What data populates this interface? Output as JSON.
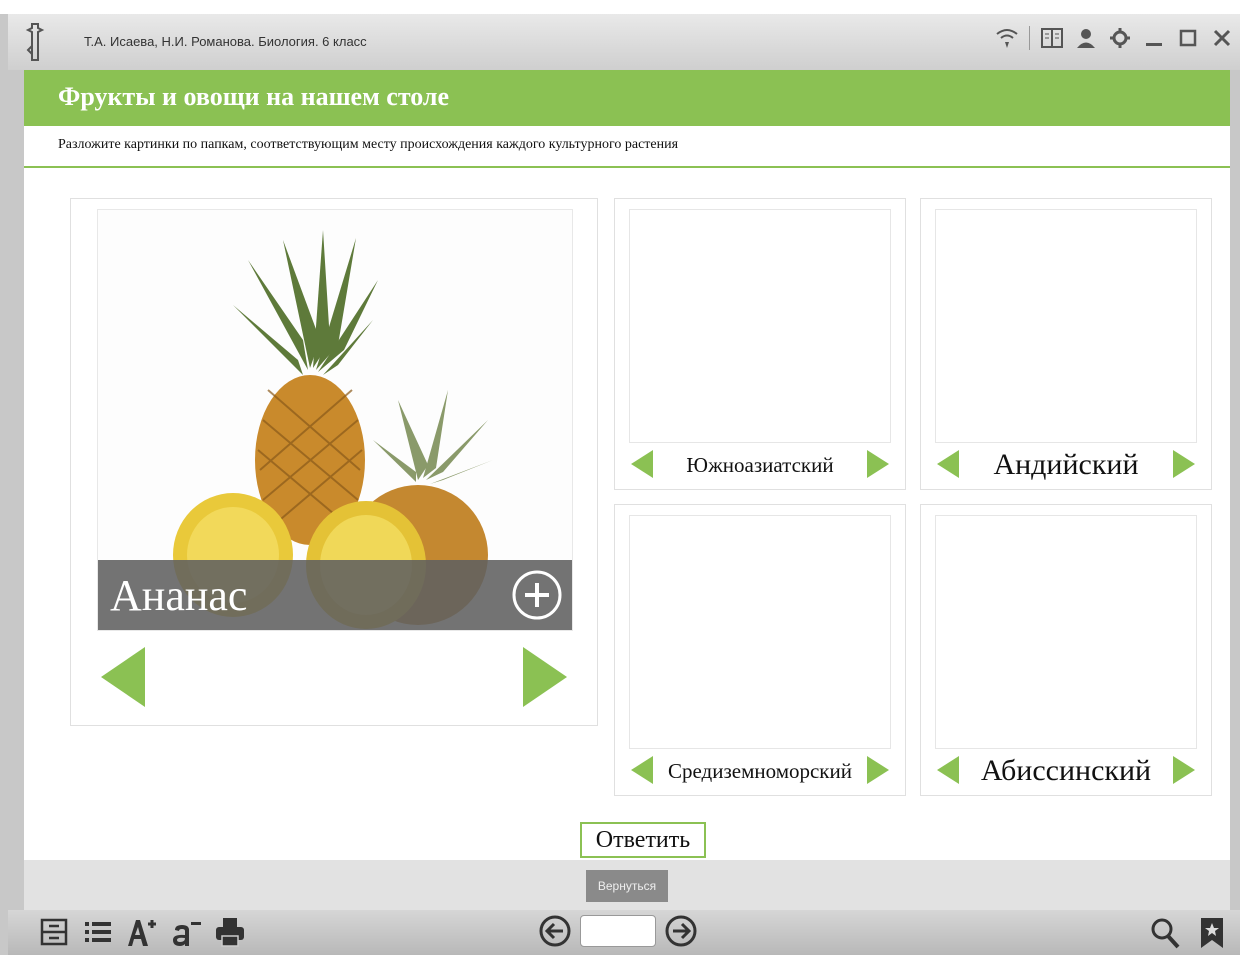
{
  "window": {
    "title": "Т.А. Исаева, Н.И. Романова. Биология. 6 класс"
  },
  "lesson": {
    "title": "Фрукты и овощи на нашем столе",
    "instruction": "Разложите картинки по папкам, соответствующим месту происхождения каждого культурного растения"
  },
  "card": {
    "caption": "Ананас"
  },
  "folders": [
    {
      "label": "Южноазиатский"
    },
    {
      "label": "Андийский"
    },
    {
      "label": "Средиземноморский"
    },
    {
      "label": "Абиссинский"
    }
  ],
  "buttons": {
    "answer": "Ответить",
    "back": "Вернуться"
  },
  "pager": {
    "value": ""
  },
  "colors": {
    "accent": "#8bc153",
    "caption_bg": "#606060"
  }
}
